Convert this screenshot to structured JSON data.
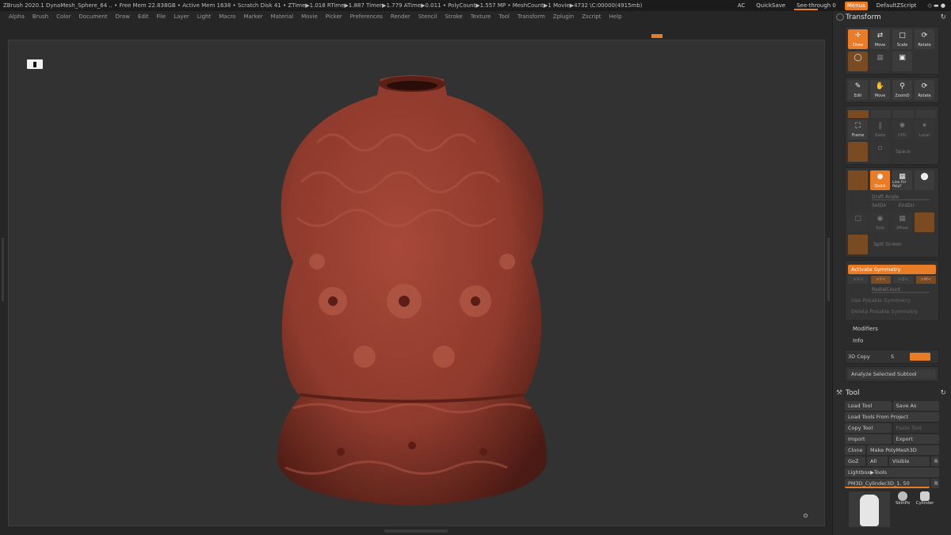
{
  "topbar": {
    "status": "ZBrush 2020.1    DynaMesh_Sphere_64    .. • Free Mem 22.838GB • Active Mem 1638 • Scratch Disk 41 •  ZTime▶1.018 RTime▶1.887 Timer▶1.779 ATime▶0.011 • PolyCount▶1.557 MP  • MeshCount▶1  Movie▶4732 \\C:00000(4915mb)",
    "ac": "AC",
    "quicksave": "QuickSave",
    "see_through": "See-through  0",
    "menus": "Menus",
    "script": "DefaultZScript"
  },
  "menubar": [
    "Alpha",
    "Brush",
    "Color",
    "Document",
    "Draw",
    "Edit",
    "File",
    "Layer",
    "Light",
    "Macro",
    "Marker",
    "Material",
    "Movie",
    "Picker",
    "Preferences",
    "Render",
    "Stencil",
    "Stroke",
    "Texture",
    "Tool",
    "Transform",
    "Zplugin",
    "Zscript",
    "Help"
  ],
  "transform": {
    "title": "Transform",
    "row1": [
      "Draw",
      "Move",
      "Scale",
      "Rotate"
    ],
    "row3": [
      "Edit",
      "Move",
      "ZoomD",
      "Rotate"
    ],
    "row4": [
      "Frame",
      "Zaxis",
      "CPU",
      "Local"
    ],
    "spotlight": "Space",
    "row5": [
      "",
      "Quick",
      "Line Fill PolyF",
      ""
    ],
    "draft": "Draft Angle",
    "setdir": "SetDir",
    "enddir": "EndDir",
    "solo": "Solo",
    "xpose": "XPose",
    "split_screen": "Split Screen",
    "activate_symmetry": "Activate Symmetry",
    "sym_axes": [
      ">X<",
      ">Y<",
      ">Z<",
      ">M<"
    ],
    "radial": "RadialCount",
    "use_posable": "Use Posable Symmetry",
    "delete_posable": "Delete Posable Symmetry",
    "modifiers": "Modifiers",
    "info": "Info",
    "copy3d": "3D Copy",
    "copy3d_s": "S",
    "analyze": "Analyze Selected Subtool"
  },
  "tool": {
    "title": "Tool",
    "load": "Load Tool",
    "save_as": "Save As",
    "load_project": "Load Tools From Project",
    "copy": "Copy Tool",
    "paste": "Paste Tool",
    "import": "Import",
    "export": "Export",
    "clone": "Clone",
    "make_polymesh": "Make PolyMesh3D",
    "goz": "GoZ",
    "all": "All",
    "visible": "Visible",
    "r": "R",
    "lightbox": "Lightbox▶Tools",
    "current": "PM3D_Cylinder3D_1. 50",
    "current_r": "R",
    "thumb1": "SkinPo",
    "thumb2": "Cylinder"
  },
  "colors": {
    "accent": "#e87c27",
    "vase": "#8e3a2c"
  }
}
